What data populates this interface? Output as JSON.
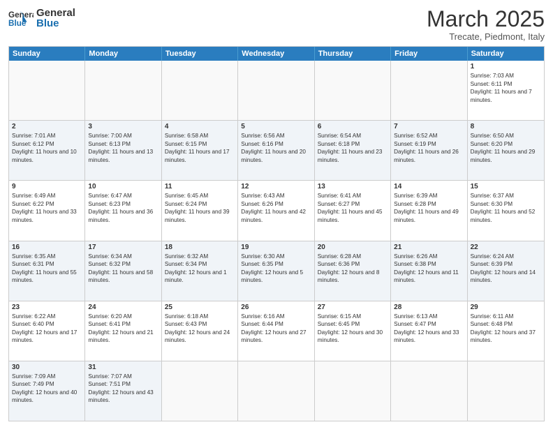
{
  "header": {
    "logo_general": "General",
    "logo_blue": "Blue",
    "month_title": "March 2025",
    "subtitle": "Trecate, Piedmont, Italy"
  },
  "weekdays": [
    "Sunday",
    "Monday",
    "Tuesday",
    "Wednesday",
    "Thursday",
    "Friday",
    "Saturday"
  ],
  "rows": [
    [
      {
        "day": "",
        "text": "",
        "empty": true
      },
      {
        "day": "",
        "text": "",
        "empty": true
      },
      {
        "day": "",
        "text": "",
        "empty": true
      },
      {
        "day": "",
        "text": "",
        "empty": true
      },
      {
        "day": "",
        "text": "",
        "empty": true
      },
      {
        "day": "",
        "text": "",
        "empty": true
      },
      {
        "day": "1",
        "text": "Sunrise: 7:03 AM\nSunset: 6:11 PM\nDaylight: 11 hours and 7 minutes.",
        "empty": false
      }
    ],
    [
      {
        "day": "2",
        "text": "Sunrise: 7:01 AM\nSunset: 6:12 PM\nDaylight: 11 hours and 10 minutes.",
        "empty": false
      },
      {
        "day": "3",
        "text": "Sunrise: 7:00 AM\nSunset: 6:13 PM\nDaylight: 11 hours and 13 minutes.",
        "empty": false
      },
      {
        "day": "4",
        "text": "Sunrise: 6:58 AM\nSunset: 6:15 PM\nDaylight: 11 hours and 17 minutes.",
        "empty": false
      },
      {
        "day": "5",
        "text": "Sunrise: 6:56 AM\nSunset: 6:16 PM\nDaylight: 11 hours and 20 minutes.",
        "empty": false
      },
      {
        "day": "6",
        "text": "Sunrise: 6:54 AM\nSunset: 6:18 PM\nDaylight: 11 hours and 23 minutes.",
        "empty": false
      },
      {
        "day": "7",
        "text": "Sunrise: 6:52 AM\nSunset: 6:19 PM\nDaylight: 11 hours and 26 minutes.",
        "empty": false
      },
      {
        "day": "8",
        "text": "Sunrise: 6:50 AM\nSunset: 6:20 PM\nDaylight: 11 hours and 29 minutes.",
        "empty": false
      }
    ],
    [
      {
        "day": "9",
        "text": "Sunrise: 6:49 AM\nSunset: 6:22 PM\nDaylight: 11 hours and 33 minutes.",
        "empty": false
      },
      {
        "day": "10",
        "text": "Sunrise: 6:47 AM\nSunset: 6:23 PM\nDaylight: 11 hours and 36 minutes.",
        "empty": false
      },
      {
        "day": "11",
        "text": "Sunrise: 6:45 AM\nSunset: 6:24 PM\nDaylight: 11 hours and 39 minutes.",
        "empty": false
      },
      {
        "day": "12",
        "text": "Sunrise: 6:43 AM\nSunset: 6:26 PM\nDaylight: 11 hours and 42 minutes.",
        "empty": false
      },
      {
        "day": "13",
        "text": "Sunrise: 6:41 AM\nSunset: 6:27 PM\nDaylight: 11 hours and 45 minutes.",
        "empty": false
      },
      {
        "day": "14",
        "text": "Sunrise: 6:39 AM\nSunset: 6:28 PM\nDaylight: 11 hours and 49 minutes.",
        "empty": false
      },
      {
        "day": "15",
        "text": "Sunrise: 6:37 AM\nSunset: 6:30 PM\nDaylight: 11 hours and 52 minutes.",
        "empty": false
      }
    ],
    [
      {
        "day": "16",
        "text": "Sunrise: 6:35 AM\nSunset: 6:31 PM\nDaylight: 11 hours and 55 minutes.",
        "empty": false
      },
      {
        "day": "17",
        "text": "Sunrise: 6:34 AM\nSunset: 6:32 PM\nDaylight: 11 hours and 58 minutes.",
        "empty": false
      },
      {
        "day": "18",
        "text": "Sunrise: 6:32 AM\nSunset: 6:34 PM\nDaylight: 12 hours and 1 minute.",
        "empty": false
      },
      {
        "day": "19",
        "text": "Sunrise: 6:30 AM\nSunset: 6:35 PM\nDaylight: 12 hours and 5 minutes.",
        "empty": false
      },
      {
        "day": "20",
        "text": "Sunrise: 6:28 AM\nSunset: 6:36 PM\nDaylight: 12 hours and 8 minutes.",
        "empty": false
      },
      {
        "day": "21",
        "text": "Sunrise: 6:26 AM\nSunset: 6:38 PM\nDaylight: 12 hours and 11 minutes.",
        "empty": false
      },
      {
        "day": "22",
        "text": "Sunrise: 6:24 AM\nSunset: 6:39 PM\nDaylight: 12 hours and 14 minutes.",
        "empty": false
      }
    ],
    [
      {
        "day": "23",
        "text": "Sunrise: 6:22 AM\nSunset: 6:40 PM\nDaylight: 12 hours and 17 minutes.",
        "empty": false
      },
      {
        "day": "24",
        "text": "Sunrise: 6:20 AM\nSunset: 6:41 PM\nDaylight: 12 hours and 21 minutes.",
        "empty": false
      },
      {
        "day": "25",
        "text": "Sunrise: 6:18 AM\nSunset: 6:43 PM\nDaylight: 12 hours and 24 minutes.",
        "empty": false
      },
      {
        "day": "26",
        "text": "Sunrise: 6:16 AM\nSunset: 6:44 PM\nDaylight: 12 hours and 27 minutes.",
        "empty": false
      },
      {
        "day": "27",
        "text": "Sunrise: 6:15 AM\nSunset: 6:45 PM\nDaylight: 12 hours and 30 minutes.",
        "empty": false
      },
      {
        "day": "28",
        "text": "Sunrise: 6:13 AM\nSunset: 6:47 PM\nDaylight: 12 hours and 33 minutes.",
        "empty": false
      },
      {
        "day": "29",
        "text": "Sunrise: 6:11 AM\nSunset: 6:48 PM\nDaylight: 12 hours and 37 minutes.",
        "empty": false
      }
    ],
    [
      {
        "day": "30",
        "text": "Sunrise: 7:09 AM\nSunset: 7:49 PM\nDaylight: 12 hours and 40 minutes.",
        "empty": false
      },
      {
        "day": "31",
        "text": "Sunrise: 7:07 AM\nSunset: 7:51 PM\nDaylight: 12 hours and 43 minutes.",
        "empty": false
      },
      {
        "day": "",
        "text": "",
        "empty": true
      },
      {
        "day": "",
        "text": "",
        "empty": true
      },
      {
        "day": "",
        "text": "",
        "empty": true
      },
      {
        "day": "",
        "text": "",
        "empty": true
      },
      {
        "day": "",
        "text": "",
        "empty": true
      }
    ]
  ]
}
